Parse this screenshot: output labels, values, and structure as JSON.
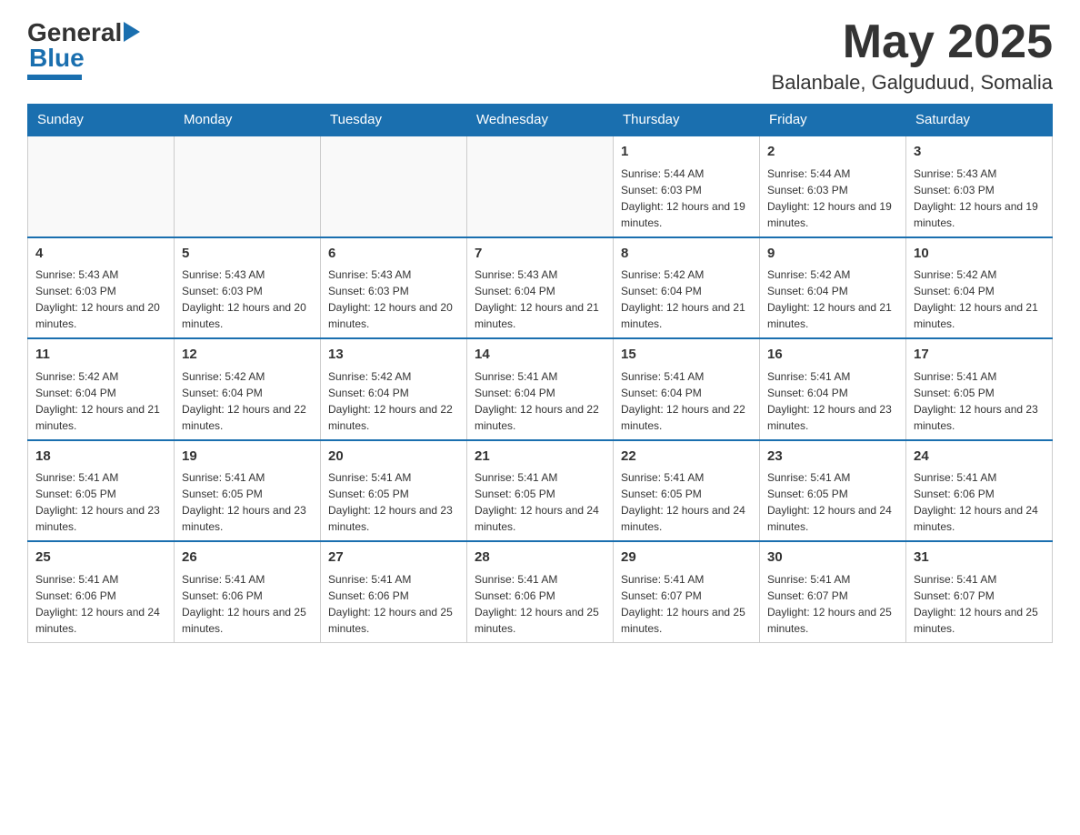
{
  "header": {
    "logo_general": "General",
    "logo_blue": "Blue",
    "month_title": "May 2025",
    "location": "Balanbale, Galguduud, Somalia"
  },
  "calendar": {
    "days_of_week": [
      "Sunday",
      "Monday",
      "Tuesday",
      "Wednesday",
      "Thursday",
      "Friday",
      "Saturday"
    ],
    "weeks": [
      [
        {
          "day": "",
          "info": ""
        },
        {
          "day": "",
          "info": ""
        },
        {
          "day": "",
          "info": ""
        },
        {
          "day": "",
          "info": ""
        },
        {
          "day": "1",
          "info": "Sunrise: 5:44 AM\nSunset: 6:03 PM\nDaylight: 12 hours and 19 minutes."
        },
        {
          "day": "2",
          "info": "Sunrise: 5:44 AM\nSunset: 6:03 PM\nDaylight: 12 hours and 19 minutes."
        },
        {
          "day": "3",
          "info": "Sunrise: 5:43 AM\nSunset: 6:03 PM\nDaylight: 12 hours and 19 minutes."
        }
      ],
      [
        {
          "day": "4",
          "info": "Sunrise: 5:43 AM\nSunset: 6:03 PM\nDaylight: 12 hours and 20 minutes."
        },
        {
          "day": "5",
          "info": "Sunrise: 5:43 AM\nSunset: 6:03 PM\nDaylight: 12 hours and 20 minutes."
        },
        {
          "day": "6",
          "info": "Sunrise: 5:43 AM\nSunset: 6:03 PM\nDaylight: 12 hours and 20 minutes."
        },
        {
          "day": "7",
          "info": "Sunrise: 5:43 AM\nSunset: 6:04 PM\nDaylight: 12 hours and 21 minutes."
        },
        {
          "day": "8",
          "info": "Sunrise: 5:42 AM\nSunset: 6:04 PM\nDaylight: 12 hours and 21 minutes."
        },
        {
          "day": "9",
          "info": "Sunrise: 5:42 AM\nSunset: 6:04 PM\nDaylight: 12 hours and 21 minutes."
        },
        {
          "day": "10",
          "info": "Sunrise: 5:42 AM\nSunset: 6:04 PM\nDaylight: 12 hours and 21 minutes."
        }
      ],
      [
        {
          "day": "11",
          "info": "Sunrise: 5:42 AM\nSunset: 6:04 PM\nDaylight: 12 hours and 21 minutes."
        },
        {
          "day": "12",
          "info": "Sunrise: 5:42 AM\nSunset: 6:04 PM\nDaylight: 12 hours and 22 minutes."
        },
        {
          "day": "13",
          "info": "Sunrise: 5:42 AM\nSunset: 6:04 PM\nDaylight: 12 hours and 22 minutes."
        },
        {
          "day": "14",
          "info": "Sunrise: 5:41 AM\nSunset: 6:04 PM\nDaylight: 12 hours and 22 minutes."
        },
        {
          "day": "15",
          "info": "Sunrise: 5:41 AM\nSunset: 6:04 PM\nDaylight: 12 hours and 22 minutes."
        },
        {
          "day": "16",
          "info": "Sunrise: 5:41 AM\nSunset: 6:04 PM\nDaylight: 12 hours and 23 minutes."
        },
        {
          "day": "17",
          "info": "Sunrise: 5:41 AM\nSunset: 6:05 PM\nDaylight: 12 hours and 23 minutes."
        }
      ],
      [
        {
          "day": "18",
          "info": "Sunrise: 5:41 AM\nSunset: 6:05 PM\nDaylight: 12 hours and 23 minutes."
        },
        {
          "day": "19",
          "info": "Sunrise: 5:41 AM\nSunset: 6:05 PM\nDaylight: 12 hours and 23 minutes."
        },
        {
          "day": "20",
          "info": "Sunrise: 5:41 AM\nSunset: 6:05 PM\nDaylight: 12 hours and 23 minutes."
        },
        {
          "day": "21",
          "info": "Sunrise: 5:41 AM\nSunset: 6:05 PM\nDaylight: 12 hours and 24 minutes."
        },
        {
          "day": "22",
          "info": "Sunrise: 5:41 AM\nSunset: 6:05 PM\nDaylight: 12 hours and 24 minutes."
        },
        {
          "day": "23",
          "info": "Sunrise: 5:41 AM\nSunset: 6:05 PM\nDaylight: 12 hours and 24 minutes."
        },
        {
          "day": "24",
          "info": "Sunrise: 5:41 AM\nSunset: 6:06 PM\nDaylight: 12 hours and 24 minutes."
        }
      ],
      [
        {
          "day": "25",
          "info": "Sunrise: 5:41 AM\nSunset: 6:06 PM\nDaylight: 12 hours and 24 minutes."
        },
        {
          "day": "26",
          "info": "Sunrise: 5:41 AM\nSunset: 6:06 PM\nDaylight: 12 hours and 25 minutes."
        },
        {
          "day": "27",
          "info": "Sunrise: 5:41 AM\nSunset: 6:06 PM\nDaylight: 12 hours and 25 minutes."
        },
        {
          "day": "28",
          "info": "Sunrise: 5:41 AM\nSunset: 6:06 PM\nDaylight: 12 hours and 25 minutes."
        },
        {
          "day": "29",
          "info": "Sunrise: 5:41 AM\nSunset: 6:07 PM\nDaylight: 12 hours and 25 minutes."
        },
        {
          "day": "30",
          "info": "Sunrise: 5:41 AM\nSunset: 6:07 PM\nDaylight: 12 hours and 25 minutes."
        },
        {
          "day": "31",
          "info": "Sunrise: 5:41 AM\nSunset: 6:07 PM\nDaylight: 12 hours and 25 minutes."
        }
      ]
    ]
  }
}
